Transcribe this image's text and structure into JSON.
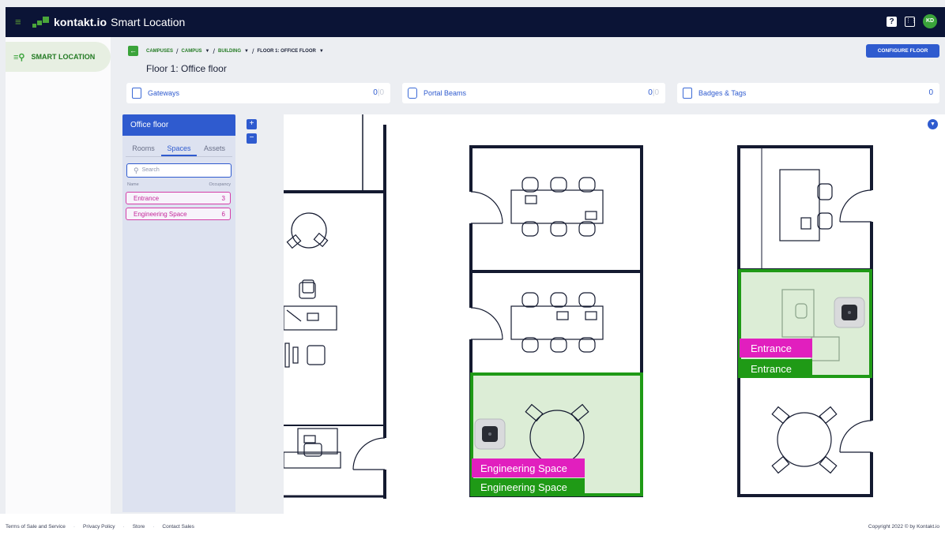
{
  "app": {
    "brand": "kontakt.io",
    "title": "Smart Location",
    "avatar_initials": "KD",
    "help_label": "?",
    "accent": "#2f5bcf",
    "brand_green": "#3aa33a",
    "topbar_bg": "#0b1436"
  },
  "sidebar": {
    "items": [
      {
        "icon": "map-pin-list-icon",
        "label": "SMART LOCATION"
      }
    ]
  },
  "breadcrumb": {
    "campuses": "CAMPUSES",
    "campus": "CAMPUS",
    "building": "BUILDING",
    "floor": "FLOOR 1: OFFICE FLOOR",
    "sep": "/"
  },
  "page": {
    "title": "Floor 1: Office floor",
    "configure_label": "CONFIGURE FLOOR"
  },
  "stats": [
    {
      "icon": "gateway-icon",
      "label": "Gateways",
      "value": "0",
      "value2": "0"
    },
    {
      "icon": "portal-beam-icon",
      "label": "Portal Beams",
      "value": "0",
      "value2": "0"
    },
    {
      "icon": "badge-tag-icon",
      "label": "Badges & Tags",
      "value": "0"
    }
  ],
  "panel": {
    "header": "Office floor",
    "tabs": [
      "Rooms",
      "Spaces",
      "Assets"
    ],
    "active_tab": "Spaces",
    "search_placeholder": "Search",
    "col_name": "Name",
    "col_occupancy": "Occupancy",
    "spaces": [
      {
        "name": "Entrance",
        "occupancy": "3"
      },
      {
        "name": "Engineering Space",
        "occupancy": "6"
      }
    ]
  },
  "map": {
    "zoom_in": "+",
    "zoom_out": "−",
    "labels": {
      "entrance_a": "Entrance",
      "entrance_b": "Entrance",
      "engineering_a": "Engineering Space",
      "engineering_b": "Engineering Space"
    },
    "highlight_magenta": "#e11fbe",
    "highlight_green": "#1f9a16"
  },
  "footer": {
    "links": [
      "Terms of Sale and Service",
      "Privacy Policy",
      "Store",
      "Contact Sales"
    ],
    "copyright": "Copyright 2022 © by Kontakt.io"
  }
}
